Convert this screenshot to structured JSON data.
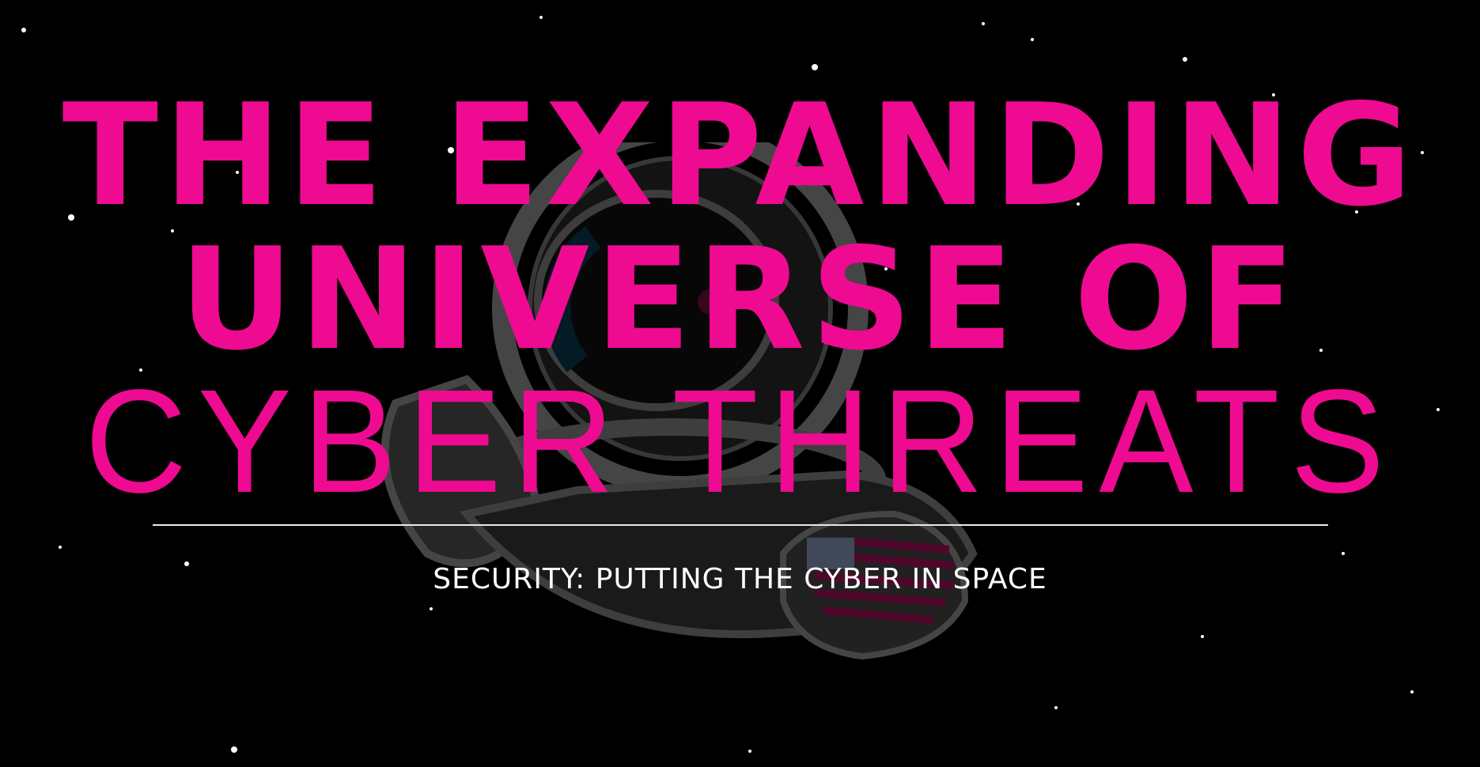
{
  "hero": {
    "title_line1": "THE EXPANDING",
    "title_line2": "UNIVERSE OF",
    "title_line3": "CYBER THREATS",
    "subtitle": "SECURITY: PUTTING THE CYBER IN SPACE"
  },
  "colors": {
    "background": "#000000",
    "accent_pink": "#ee0a91",
    "subtitle_white": "#ffffff",
    "visor_blue": "#0b3a53"
  },
  "icons": [
    "astronaut-illustration",
    "star-icon",
    "american-flag-patch"
  ]
}
